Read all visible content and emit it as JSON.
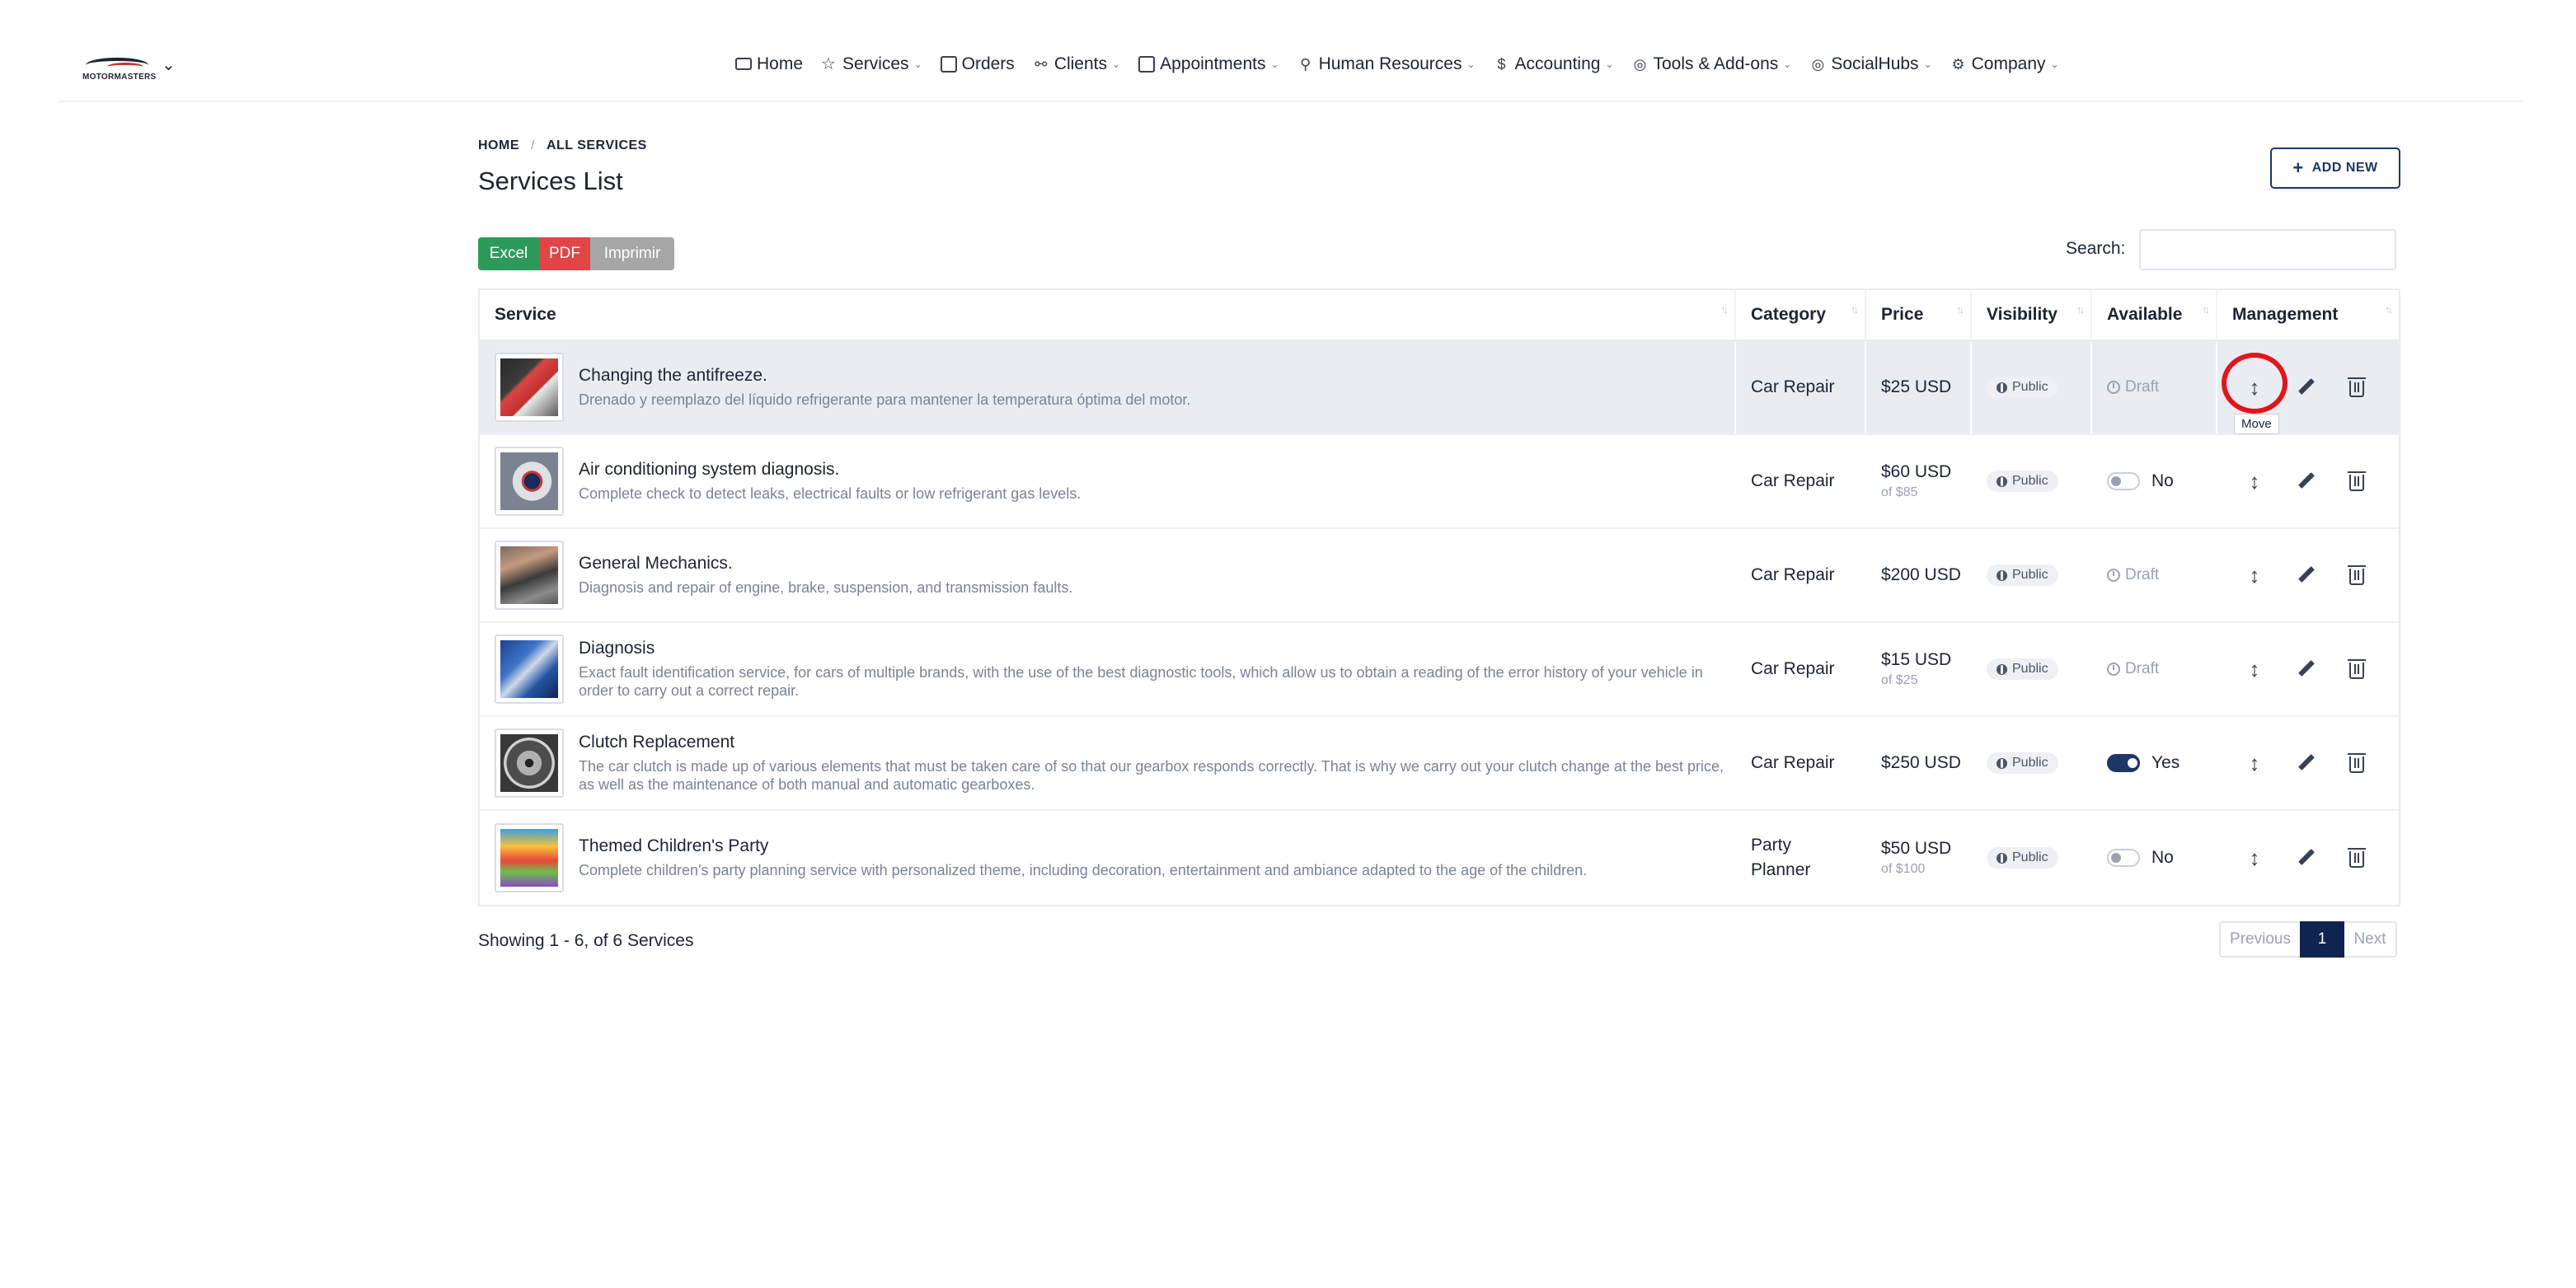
{
  "brand": {
    "logo_text": "MOTORMASTERS"
  },
  "nav": [
    {
      "label": "Home",
      "icon": "monitor-icon",
      "caret": false
    },
    {
      "label": "Services",
      "icon": "star-icon",
      "caret": true
    },
    {
      "label": "Orders",
      "icon": "clipboard-icon",
      "caret": false
    },
    {
      "label": "Clients",
      "icon": "users-icon",
      "caret": true
    },
    {
      "label": "Appointments",
      "icon": "calendar-icon",
      "caret": true
    },
    {
      "label": "Human Resources",
      "icon": "user-plus-icon",
      "caret": true
    },
    {
      "label": "Accounting",
      "icon": "dollar-icon",
      "caret": true
    },
    {
      "label": "Tools & Add-ons",
      "icon": "at-icon",
      "caret": true
    },
    {
      "label": "SocialHubs",
      "icon": "compass-icon",
      "caret": true
    },
    {
      "label": "Company",
      "icon": "gear-icon",
      "caret": true
    }
  ],
  "breadcrumb": {
    "home": "HOME",
    "current": "ALL SERVICES"
  },
  "page_title": "Services List",
  "add_button": "ADD NEW",
  "exports": {
    "excel": "Excel",
    "pdf": "PDF",
    "print": "Imprimir"
  },
  "search": {
    "label": "Search:",
    "value": ""
  },
  "table": {
    "headers": {
      "service": "Service",
      "category": "Category",
      "price": "Price",
      "visibility": "Visibility",
      "available": "Available",
      "management": "Management"
    },
    "rows": [
      {
        "title": "Changing the antifreeze.",
        "desc": "Drenado y reemplazo del líquido refrigerante para mantener la temperatura óptima del motor.",
        "category": "Car Repair",
        "price": "$25 USD",
        "price_sub": "",
        "visibility": "Public",
        "available": "Draft"
      },
      {
        "title": "Air conditioning system diagnosis.",
        "desc": "Complete check to detect leaks, electrical faults or low refrigerant gas levels.",
        "category": "Car Repair",
        "price": "$60 USD",
        "price_sub": "of $85",
        "visibility": "Public",
        "available": "No"
      },
      {
        "title": "General Mechanics.",
        "desc": "Diagnosis and repair of engine, brake, suspension, and transmission faults.",
        "category": "Car Repair",
        "price": "$200 USD",
        "price_sub": "",
        "visibility": "Public",
        "available": "Draft"
      },
      {
        "title": "Diagnosis",
        "desc": "Exact fault identification service, for cars of multiple brands, with the use of the best diagnostic tools, which allow us to obtain a reading of the error history of your vehicle in order to carry out a correct repair.",
        "category": "Car Repair",
        "price": "$15 USD",
        "price_sub": "of $25",
        "visibility": "Public",
        "available": "Draft"
      },
      {
        "title": "Clutch Replacement",
        "desc": "The car clutch is made up of various elements that must be taken care of so that our gearbox responds correctly. That is why we carry out your clutch change at the best price, as well as the maintenance of both manual and automatic gearboxes.",
        "category": "Car Repair",
        "price": "$250 USD",
        "price_sub": "",
        "visibility": "Public",
        "available": "Yes"
      },
      {
        "title": "Themed Children's Party",
        "desc": "Complete children's party planning service with personalized theme, including decoration, entertainment and ambiance adapted to the age of the children.",
        "category": "Party Planner",
        "price": "$50 USD",
        "price_sub": "of $100",
        "visibility": "Public",
        "available": "No"
      }
    ]
  },
  "tooltip": "Move",
  "footer": {
    "showing": "Showing 1 - 6, of 6 Services"
  },
  "pagination": {
    "prev": "Previous",
    "current": "1",
    "next": "Next"
  },
  "colors": {
    "primary": "#1c3666",
    "excel": "#2e9a5a",
    "pdf": "#e04646",
    "print": "#a6a6a6",
    "highlight": "#e3141b"
  }
}
